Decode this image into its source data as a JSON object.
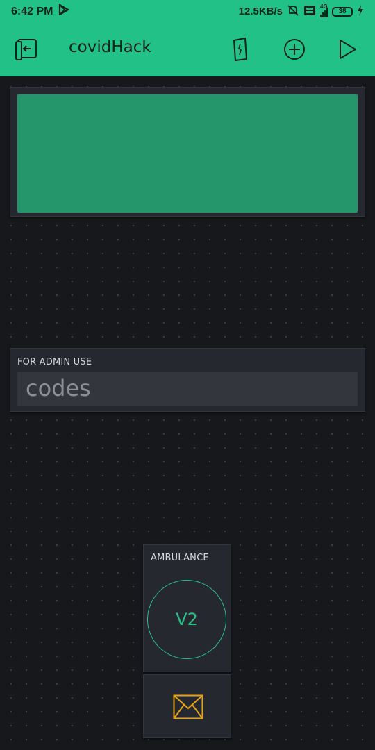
{
  "status_bar": {
    "time": "6:42 PM",
    "network_speed": "12.5KB/s",
    "network_type": "4G",
    "battery": "38"
  },
  "app_bar": {
    "title": "covidHack",
    "icons": [
      "exit-icon",
      "device-icon",
      "add-icon",
      "play-icon"
    ]
  },
  "widgets": {
    "admin_input": {
      "label": "FOR ADMIN USE",
      "value": "codes"
    },
    "ambulance_button": {
      "label": "AMBULANCE",
      "pin": "V2"
    },
    "email": {
      "icon": "email-icon"
    }
  },
  "colors": {
    "accent": "#22c187",
    "lcd": "#25956c",
    "widget_bg": "#262830",
    "email_icon": "#e6a317"
  }
}
